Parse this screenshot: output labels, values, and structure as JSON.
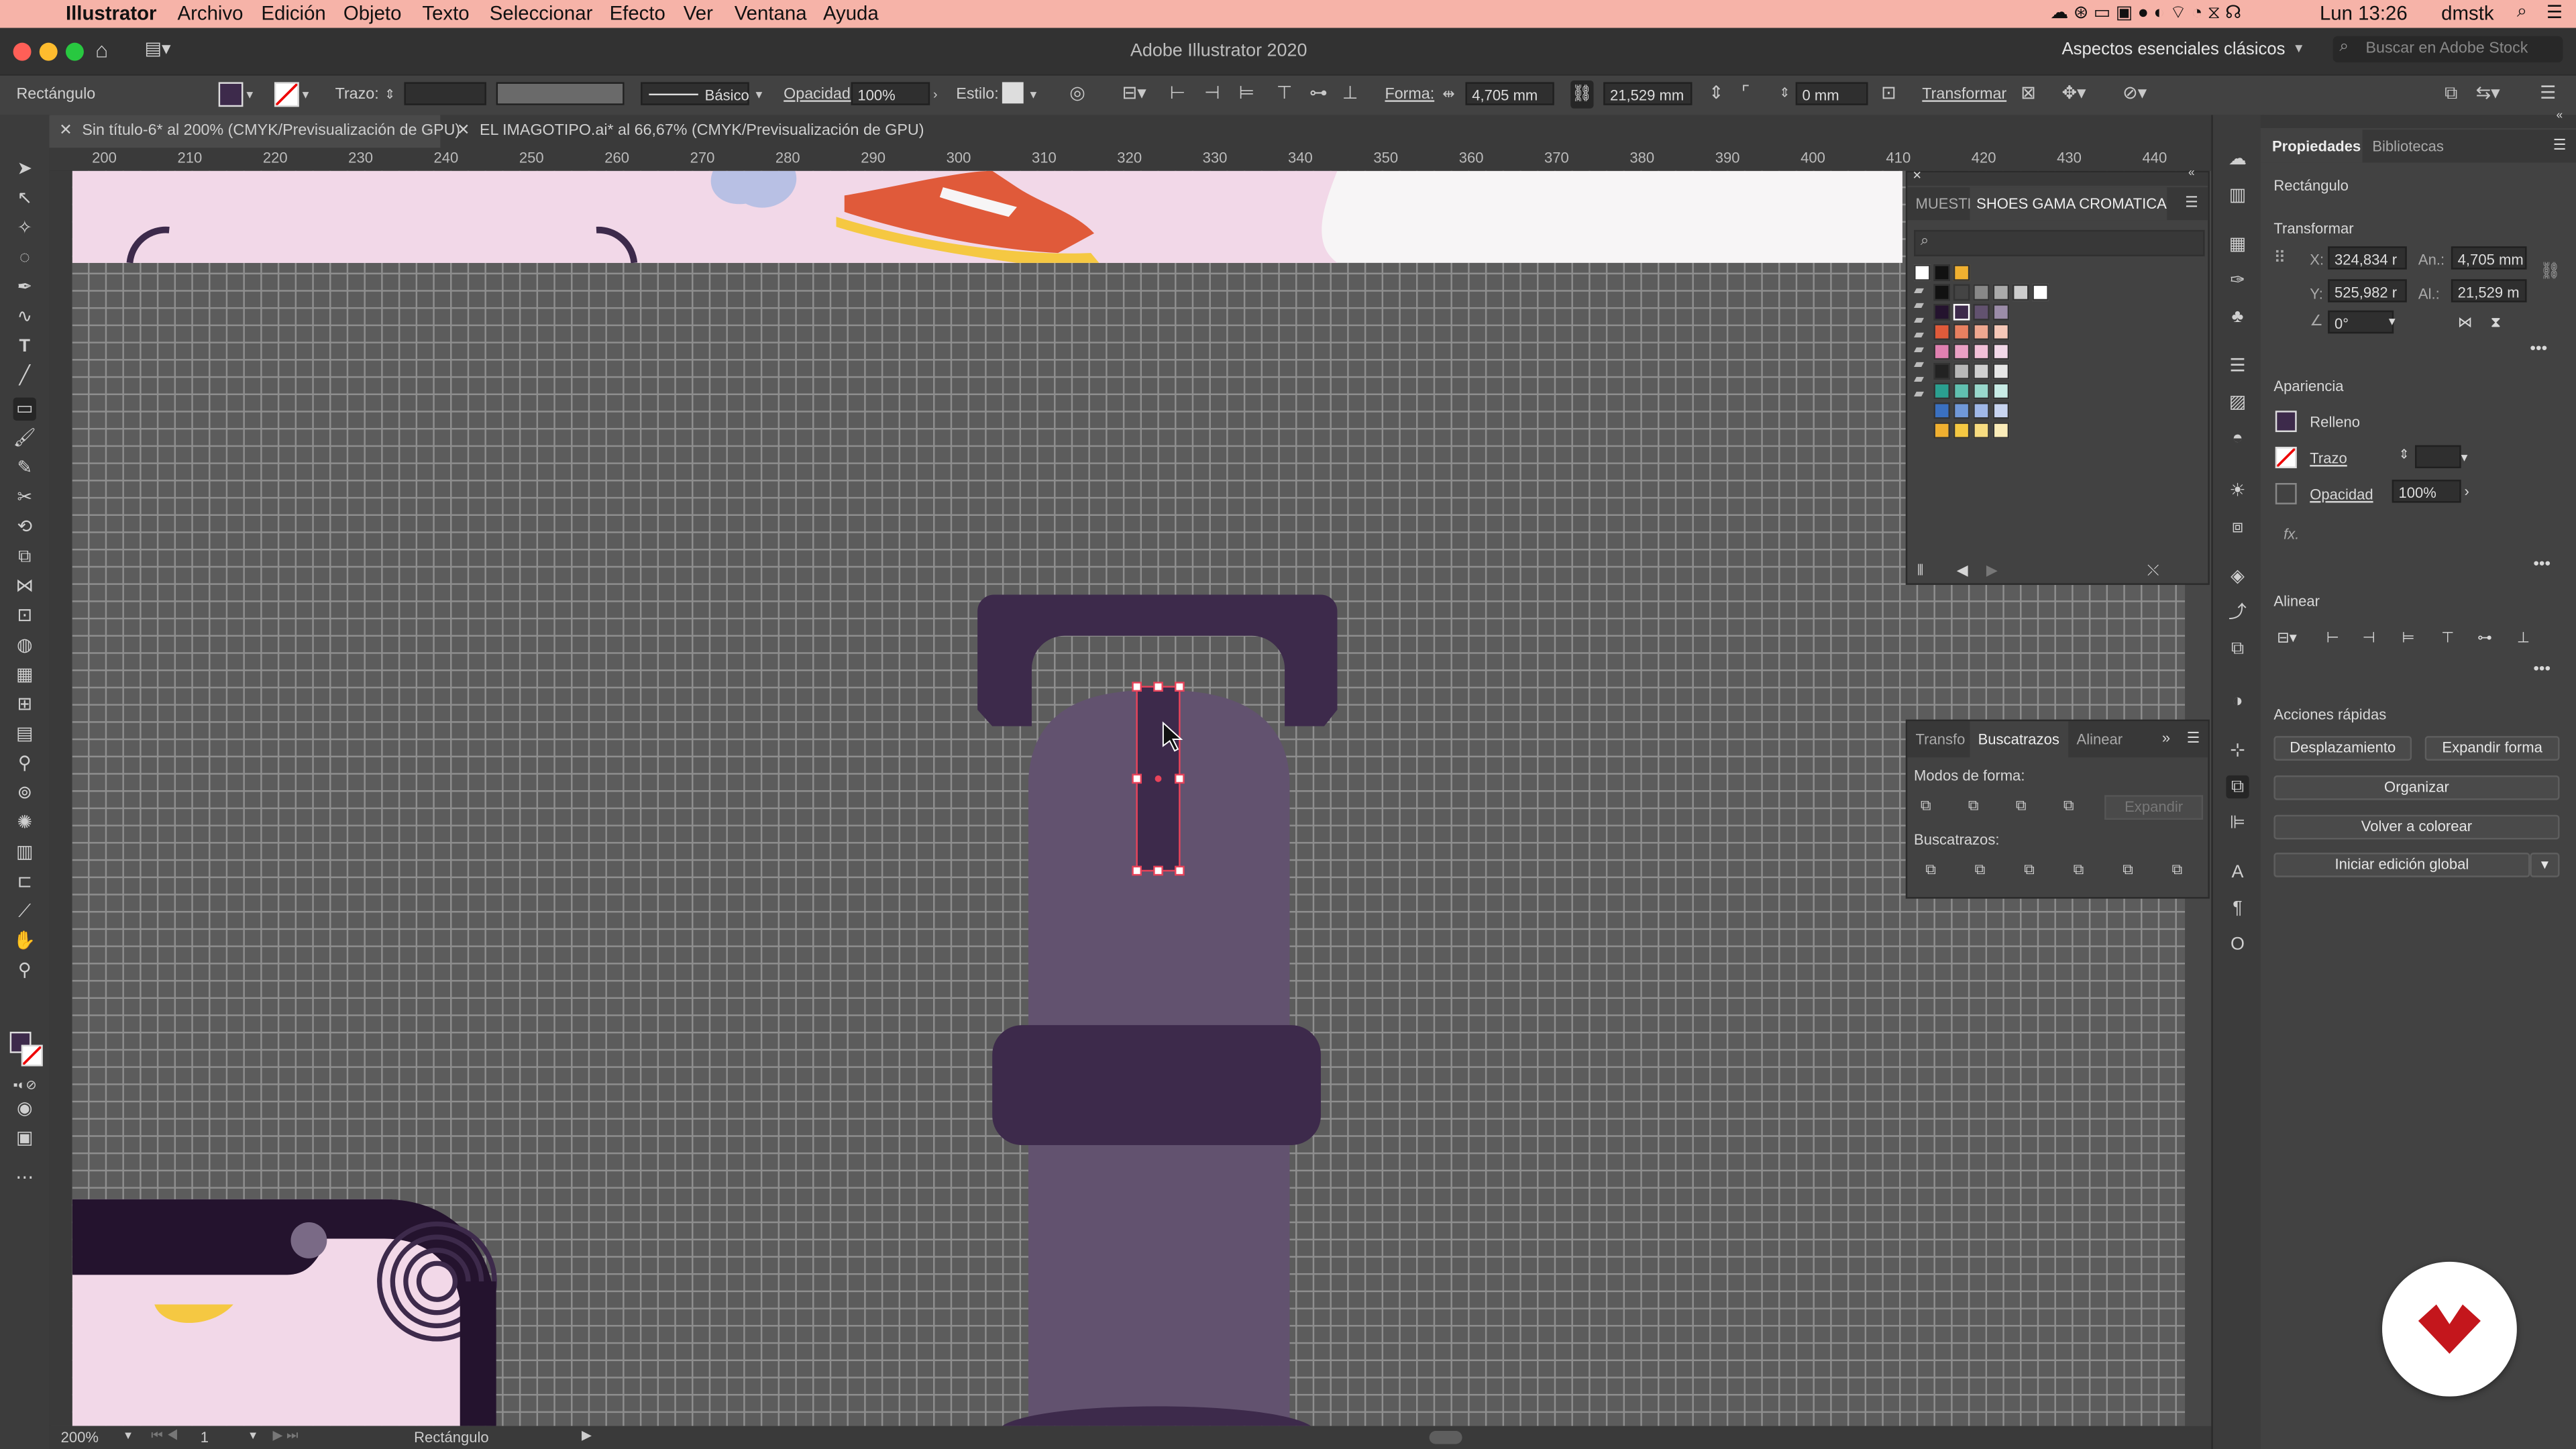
{
  "menubar": {
    "apple": "",
    "app": "Illustrator",
    "items": [
      "Archivo",
      "Edición",
      "Objeto",
      "Texto",
      "Seleccionar",
      "Efecto",
      "Ver",
      "Ventana",
      "Ayuda"
    ],
    "clock": "Lun 13:26",
    "user": "dmstk"
  },
  "titlebar": {
    "title": "Adobe Illustrator 2020",
    "workspace": "Aspectos esenciales clásicos",
    "search_placeholder": "Buscar en Adobe Stock"
  },
  "control": {
    "object_type": "Rectángulo",
    "stroke_label": "Trazo:",
    "brush_label": "Básico",
    "opacity_label": "Opacidad:",
    "opacity_value": "100%",
    "style_label": "Estilo:",
    "shape_label": "Forma:",
    "width_value": "4,705 mm",
    "height_value": "21,529 mm",
    "corner_value": "0 mm",
    "transform_label": "Transformar"
  },
  "tabs": [
    {
      "label": "Sin título-6* al 200% (CMYK/Previsualización de GPU)"
    },
    {
      "label": "EL IMAGOTIPO.ai* al 66,67% (CMYK/Previsualización de GPU)"
    }
  ],
  "ruler": [
    "200",
    "210",
    "220",
    "230",
    "240",
    "250",
    "260",
    "270",
    "280",
    "290",
    "300",
    "310",
    "320",
    "330",
    "340",
    "350",
    "360",
    "370",
    "380",
    "390",
    "400",
    "410",
    "420",
    "430",
    "440"
  ],
  "status": {
    "zoom": "200%",
    "artboard": "1",
    "tool": "Rectángulo"
  },
  "swatches_panel": {
    "tab_short": "MUESTF",
    "tab_active": "SHOES GAMA CROMATICA"
  },
  "pathfinder_panel": {
    "tab_transform": "Transfo",
    "tab_active": "Buscatrazos",
    "tab_align": "Alinear",
    "shape_modes_label": "Modos de forma:",
    "expand_label": "Expandir",
    "pathfinders_label": "Buscatrazos:"
  },
  "properties": {
    "tab_active": "Propiedades",
    "tab_libraries": "Bibliotecas",
    "object_type": "Rectángulo",
    "transform_header": "Transformar",
    "x_label": "X:",
    "x_value": "324,834 r",
    "y_label": "Y:",
    "y_value": "525,982 r",
    "w_label": "An.:",
    "w_value": "4,705 mm",
    "h_label": "Al.:",
    "h_value": "21,529 m",
    "angle_value": "0°",
    "appearance_header": "Apariencia",
    "fill_label": "Relleno",
    "stroke_label": "Trazo",
    "opacity_label": "Opacidad",
    "opacity_value": "100%",
    "fx_label": "fx.",
    "align_header": "Alinear",
    "quick_actions_header": "Acciones rápidas",
    "btn_offset": "Desplazamiento",
    "btn_expand": "Expandir forma",
    "btn_arrange": "Organizar",
    "btn_recolor": "Volver a colorear",
    "btn_global_edit": "Iniciar edición global"
  },
  "colors": {
    "menubar": "#f6b3a8",
    "dark_purple": "#3d2a4b",
    "mid_purple": "#62526f",
    "selection": "#e8435a",
    "pink_bg": "#f2d8e8",
    "orange_red": "#e05a3a",
    "yellow": "#f5c842",
    "logo_red": "#c4161c"
  }
}
